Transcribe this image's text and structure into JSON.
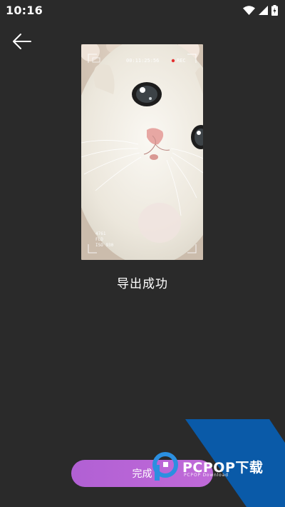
{
  "status_bar": {
    "time": "10:16",
    "icons": [
      "wifi-icon",
      "signal-icon",
      "battery-charging-icon"
    ]
  },
  "navigation": {
    "back_icon": "arrow-left-icon"
  },
  "preview": {
    "recording_time": "00:11:25:56",
    "rec_label": "REC",
    "overlay_lines": [
      "4761",
      "FLD",
      "ISO 930"
    ]
  },
  "message": {
    "text": "导出成功"
  },
  "actions": {
    "done_label": "完成"
  },
  "watermark": {
    "brand": "PCPOP下载",
    "sub": "PCPOP Download"
  },
  "colors": {
    "background": "#2a2a2a",
    "button_gradient_start": "#b160d4",
    "button_gradient_end": "#c06ad8",
    "watermark_blue": "#0a5aa8"
  }
}
